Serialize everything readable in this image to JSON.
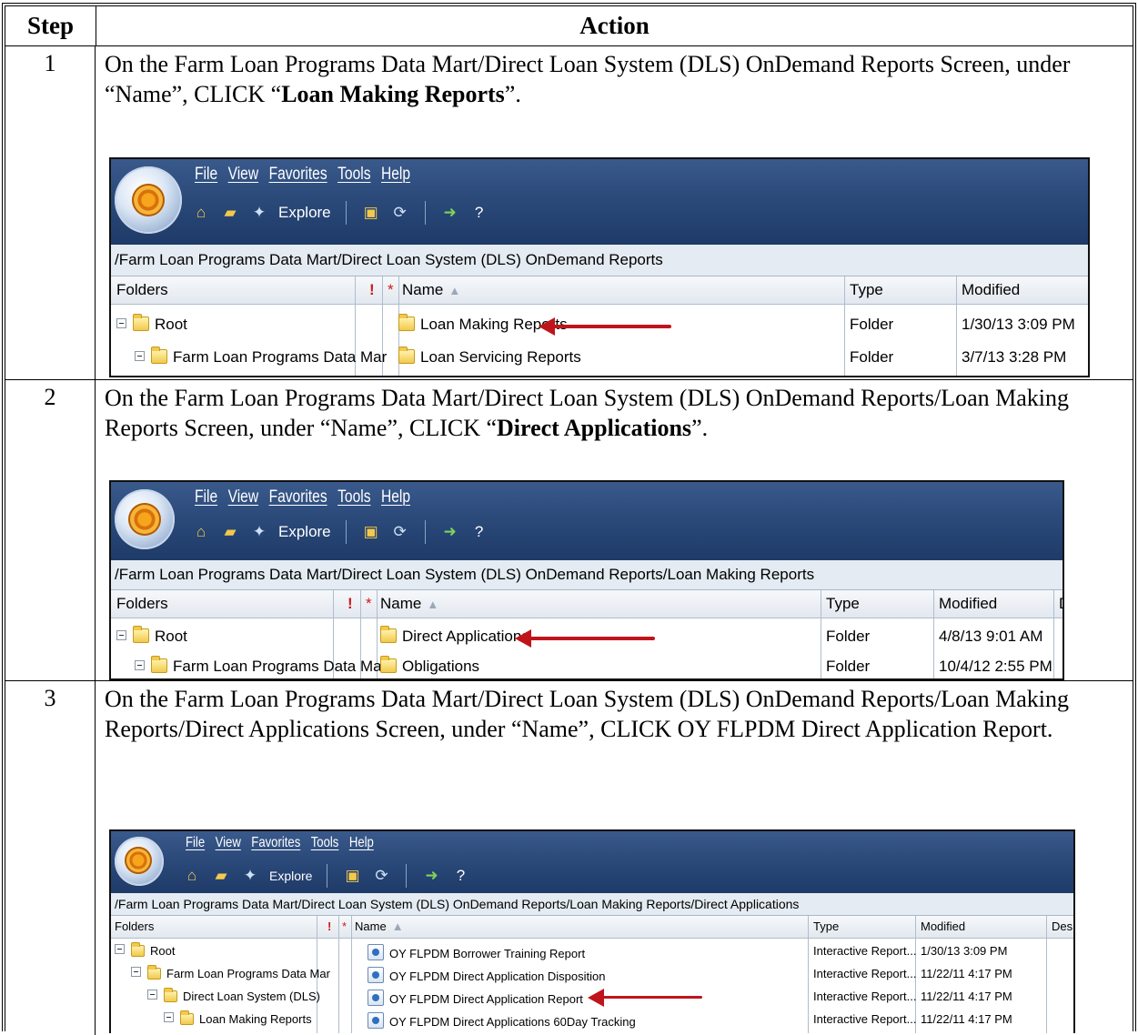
{
  "table": {
    "header_step": "Step",
    "header_action": "Action"
  },
  "steps": [
    {
      "number": "1",
      "text_pre": "On the Farm Loan Programs Data Mart/Direct Loan System (DLS) OnDemand Reports Screen, under “Name”, CLICK “",
      "text_bold": "Loan Making Reports",
      "text_post": "”.",
      "screenshot": {
        "menu": [
          "File",
          "View",
          "Favorites",
          "Tools",
          "Help"
        ],
        "explore_label": "Explore",
        "path": "/Farm Loan Programs Data Mart/Direct Loan System (DLS) OnDemand Reports",
        "columns": {
          "folders": "Folders",
          "bang": "!",
          "star": "*",
          "name": "Name",
          "type": "Type",
          "modified": "Modified"
        },
        "tree": [
          "Root",
          "Farm Loan Programs Data Mar"
        ],
        "rows": [
          {
            "name": "Loan Making Reports",
            "type": "Folder",
            "modified": "1/30/13 3:09 PM"
          },
          {
            "name": "Loan Servicing Reports",
            "type": "Folder",
            "modified": "3/7/13 3:28 PM"
          }
        ]
      }
    },
    {
      "number": "2",
      "text_pre": "On the Farm Loan Programs Data Mart/Direct Loan System (DLS) OnDemand Reports/Loan Making Reports Screen, under “Name”, CLICK “",
      "text_bold": "Direct Applications",
      "text_post": "”.",
      "screenshot": {
        "menu": [
          "File",
          "View",
          "Favorites",
          "Tools",
          "Help"
        ],
        "explore_label": "Explore",
        "path": "/Farm Loan Programs Data Mart/Direct Loan System (DLS) OnDemand Reports/Loan Making Reports",
        "columns": {
          "folders": "Folders",
          "bang": "!",
          "star": "*",
          "name": "Name",
          "type": "Type",
          "modified": "Modified",
          "desc": "D"
        },
        "tree": [
          "Root",
          "Farm Loan Programs Data Mar"
        ],
        "rows": [
          {
            "name": "Direct Applications",
            "type": "Folder",
            "modified": "4/8/13 9:01 AM"
          },
          {
            "name": "Obligations",
            "type": "Folder",
            "modified": "10/4/12 2:55 PM"
          }
        ]
      }
    },
    {
      "number": "3",
      "text": "On the Farm Loan Programs Data Mart/Direct Loan System (DLS) OnDemand Reports/Loan Making Reports/Direct Applications Screen, under “Name”, CLICK OY FLPDM Direct Application Report.",
      "screenshot": {
        "menu": [
          "File",
          "View",
          "Favorites",
          "Tools",
          "Help"
        ],
        "explore_label": "Explore",
        "path": "/Farm Loan Programs Data Mart/Direct Loan System (DLS) OnDemand Reports/Loan Making Reports/Direct Applications",
        "columns": {
          "folders": "Folders",
          "bang": "!",
          "star": "*",
          "name": "Name",
          "type": "Type",
          "modified": "Modified",
          "desc": "Des"
        },
        "tree": [
          "Root",
          "Farm Loan Programs Data Mar",
          "Direct Loan System (DLS)",
          "Loan Making Reports"
        ],
        "rows": [
          {
            "name": "OY FLPDM Borrower Training Report",
            "type": "Interactive Report...",
            "modified": "1/30/13 3:09 PM"
          },
          {
            "name": "OY FLPDM Direct Application Disposition",
            "type": "Interactive Report...",
            "modified": "11/22/11 4:17 PM"
          },
          {
            "name": "OY FLPDM Direct Application Report",
            "type": "Interactive Report...",
            "modified": "11/22/11 4:17 PM"
          },
          {
            "name": "OY FLPDM Direct Applications 60Day Tracking",
            "type": "Interactive Report...",
            "modified": "11/22/11 4:17 PM"
          }
        ]
      }
    }
  ],
  "colors": {
    "toolbar": "#2b4a7a",
    "arrow": "#c0141c",
    "path_bar": "#e4ebf2"
  }
}
